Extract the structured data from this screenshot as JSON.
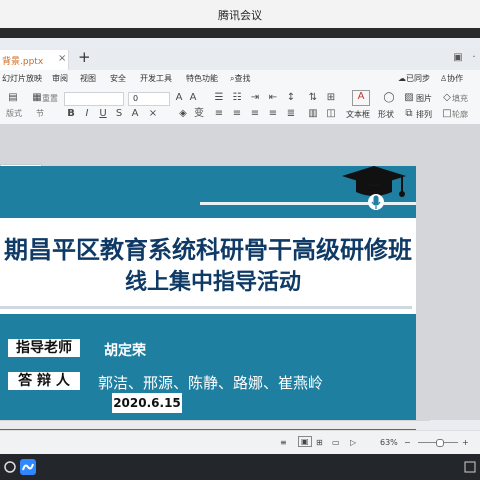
{
  "window": {
    "title": "腾讯会议"
  },
  "app": {
    "tab": {
      "name": "背景.pptx",
      "close": "×"
    },
    "new_tab": "+",
    "menu": [
      "幻灯片放映",
      "审阅",
      "视图",
      "安全",
      "开发工具",
      "特色功能",
      "查找"
    ],
    "menu_right": [
      "已同步",
      "协作"
    ],
    "toolbar": {
      "font_size_value": "0",
      "labels": [
        "重置",
        "版式",
        "节",
        "文本框",
        "形状",
        "图片",
        "排列",
        "填充",
        "轮廓"
      ]
    },
    "status": {
      "zoom": "63%",
      "zoom_minus": "−",
      "zoom_plus": "+"
    }
  },
  "slide": {
    "title_line1": "期昌平区教育系统科研骨干高级研修班",
    "title_line2": "线上集中指导活动",
    "advisor_label": "指导老师",
    "advisor_name": "胡定荣",
    "respondent_label": "答 辩 人",
    "respondent_names": "郭洁、邢源、陈静、路娜、崔燕岭",
    "date": "2020.6.15"
  },
  "colors": {
    "slide_blue": "#1e7fa0",
    "title_navy": "#0f3a66",
    "tab_orange": "#d2691e"
  }
}
